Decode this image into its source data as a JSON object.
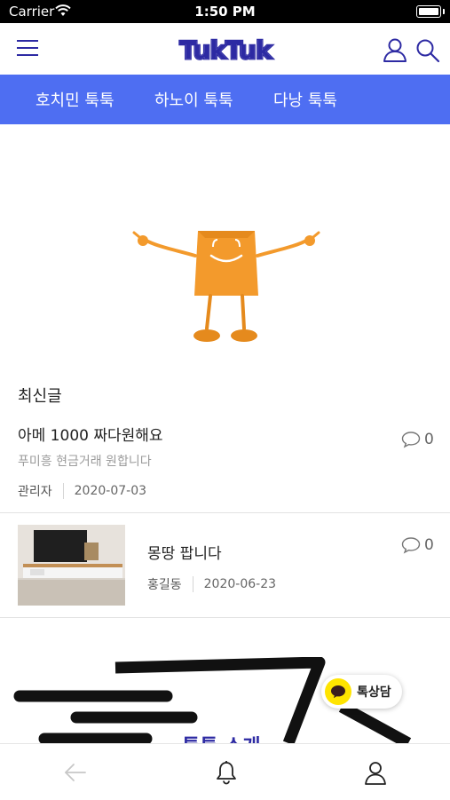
{
  "status_bar": {
    "carrier": "Carrier",
    "time": "1:50 PM"
  },
  "header": {
    "logo_text": "TukTuk"
  },
  "tabs": [
    {
      "label": "호치민 툭툭"
    },
    {
      "label": "하노이 툭툭"
    },
    {
      "label": "다낭 툭툭"
    }
  ],
  "section": {
    "title": "최신글"
  },
  "posts": [
    {
      "title": "아메 1000 짜다원해요",
      "snippet": "푸미흥 현금거래 원합니다",
      "author": "관리자",
      "date": "2020-07-03",
      "comments": "0"
    },
    {
      "title": "몽땅 팝니다",
      "author": "홍길동",
      "date": "2020-06-23",
      "comments": "0"
    }
  ],
  "banner": {
    "text": "툭툭 소개"
  },
  "kakao": {
    "label": "톡상담"
  },
  "colors": {
    "accent": "#4e6ef2",
    "logo": "#2d2aa3",
    "mascot": "#f39a2c",
    "kakao": "#ffe400"
  }
}
